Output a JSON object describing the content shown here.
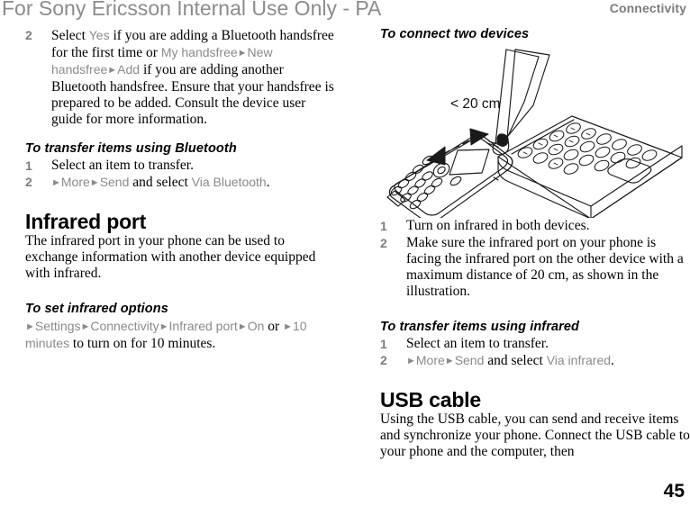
{
  "page": {
    "watermark": "For Sony Ericsson Internal Use Only - PA",
    "chapter": "Connectivity",
    "number": "45"
  },
  "left_column": {
    "bluetooth_step": {
      "num": "2",
      "t1": "Select ",
      "ui1": "Yes",
      "t2": " if you are adding a Bluetooth handsfree for the first time or ",
      "ui2": "My handsfree",
      "arrow1": "►",
      "ui3": "New handsfree",
      "arrow2": "►",
      "ui4": "Add",
      "t3": " if you are adding another Bluetooth handsfree. Ensure that your handsfree is prepared to be added. Consult the device user guide for more information."
    },
    "transfer_bluetooth": {
      "heading": "To transfer items using Bluetooth",
      "steps": [
        {
          "num": "1",
          "text": "Select an item to transfer."
        },
        {
          "num": "2",
          "arrow1": "►",
          "ui1": "More",
          "arrow2": "►",
          "ui2": "Send",
          "t1": " and select ",
          "ui3": "Via Bluetooth",
          "t2": "."
        }
      ]
    },
    "infrared": {
      "heading": "Infrared port",
      "body": "The infrared port in your phone can be used to exchange information with another device equipped with infrared."
    },
    "set_infrared_options": {
      "heading": "To set infrared options",
      "arrow1": "►",
      "ui1": "Settings",
      "arrow2": "►",
      "ui2": "Connectivity",
      "arrow3": "►",
      "ui3": "Infrared port",
      "arrow4": "►",
      "ui4": "On",
      "t1": " or ",
      "arrow5": "►",
      "ui5": "10 minutes",
      "t2": " to turn on for 10 minutes."
    }
  },
  "right_column": {
    "connect_two_devices": {
      "heading": "To connect two devices",
      "illustration": {
        "distance_label": "< 20 cm",
        "alt": "phone facing a laptop infrared port, maximum 20 cm apart"
      },
      "steps": [
        {
          "num": "1",
          "text": "Turn on infrared in both devices."
        },
        {
          "num": "2",
          "text": "Make sure the infrared port on your phone is facing the infrared port on the other device with a maximum distance of 20 cm, as shown in the illustration."
        }
      ]
    },
    "transfer_infrared": {
      "heading": "To transfer items using infrared",
      "steps": [
        {
          "num": "1",
          "text": "Select an item to transfer."
        },
        {
          "num": "2",
          "arrow1": "►",
          "ui1": "More",
          "arrow2": "►",
          "ui2": "Send",
          "t1": " and select ",
          "ui3": "Via infrared",
          "t2": "."
        }
      ]
    },
    "usb": {
      "heading": "USB cable",
      "body": "Using the USB cable, you can send and receive items and synchronize your phone. Connect the USB cable to your phone and the computer, then"
    }
  },
  "colors": {
    "ui_gray": "#8a8a8a",
    "watermark_gray": "#8c8c8c",
    "chapter_gray": "#7d7d7d",
    "text_black": "#000000"
  }
}
